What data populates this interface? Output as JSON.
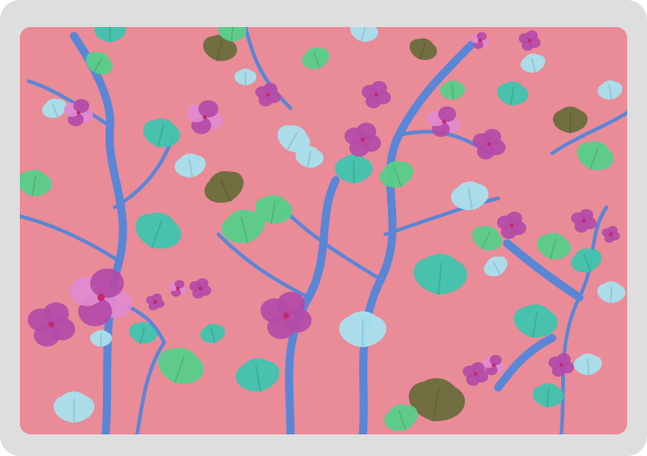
{
  "product": {
    "type": "laptop-skin",
    "pattern": "floral-branches",
    "colors": {
      "background": "#ea8b98",
      "frame": "#dedede",
      "branch": "#5a86d6",
      "flower": "#b44aa8",
      "flower_light": "#e08ad0",
      "leaf_teal": "#3fc4ae",
      "leaf_green": "#57cf8a",
      "leaf_pale": "#a8e0ee",
      "leaf_olive": "#6a6d3d"
    }
  }
}
